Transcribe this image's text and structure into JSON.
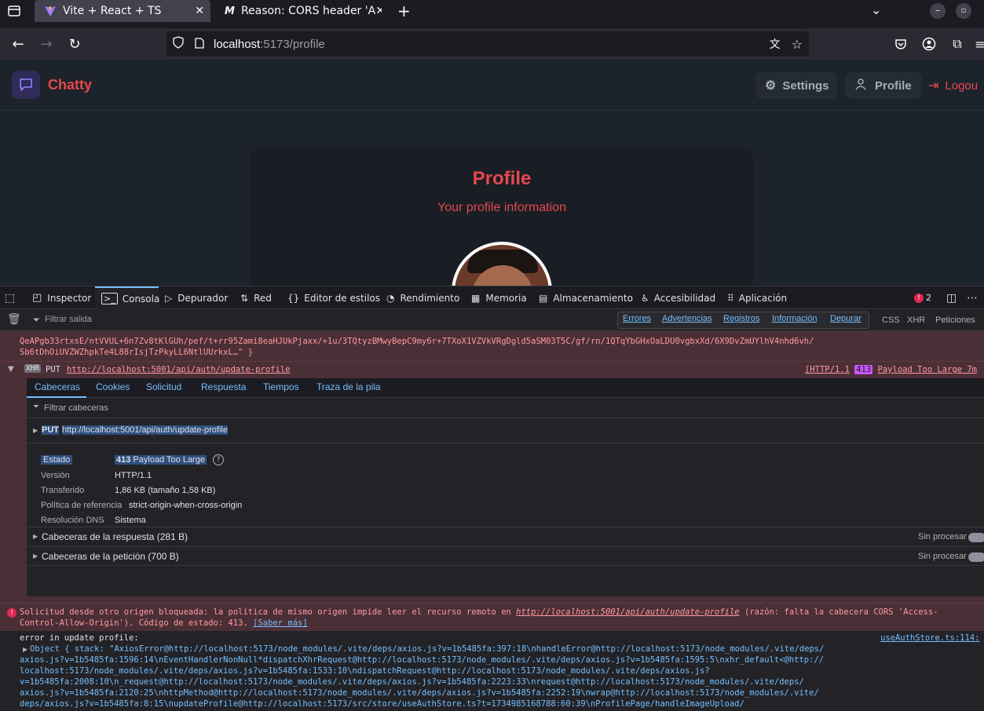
{
  "browser": {
    "tabs": [
      {
        "title": "Vite + React + TS",
        "active": true
      },
      {
        "title": "Reason: CORS header 'A",
        "active": false
      }
    ],
    "new_tab_label": "+",
    "url_host": "localhost",
    "url_rest": ":5173/profile"
  },
  "app": {
    "brand": "Chatty",
    "nav": {
      "settings": "Settings",
      "profile": "Profile",
      "logout": "Logou"
    },
    "card_title": "Profile",
    "card_subtitle": "Your profile information"
  },
  "devtools": {
    "tabs": [
      "Inspector",
      "Consola",
      "Depurador",
      "Red",
      "Editor de estilos",
      "Rendimiento",
      "Memoria",
      "Almacenamiento",
      "Accesibilidad",
      "Aplicación"
    ],
    "active_tab": "Consola",
    "error_count": "2",
    "filter_placeholder": "Filtrar salida",
    "levels": [
      "Errores",
      "Advertencias",
      "Registros",
      "Información",
      "Depurar"
    ],
    "request_types": [
      "CSS",
      "XHR",
      "Peticiones"
    ],
    "prev_log_line1": "QeAPgb33rtxsE/ntVVUL+6n7Zv8tKlGUh/pef/t+rr95Zami8eaHJUkPjaxx/+1u/3TQtyzBMwyBepC9my6r+7TXoX1VZVkVRgDgld5aSM03T5C/gf/rn/1QTqYbGHxOaLDU0vgbxXd/6X9DvZmUYlhV4nhd6vh/",
    "prev_log_line2": "Sb6tDhOiUVZWZhpkTe4L88rIsjTzPkyLL6NtlUUrkxL…\" }",
    "xhr": {
      "badge": "XHR",
      "method": "PUT",
      "url": "http://localhost:5001/api/auth/update-profile",
      "status_prefix": "[HTTP/1.1",
      "status_code": "413",
      "status_text": "Payload Too Large 7m"
    },
    "net_tabs": [
      "Cabeceras",
      "Cookies",
      "Solicitud",
      "Respuesta",
      "Tiempos",
      "Traza de la pila"
    ],
    "header_filter": "Filtrar cabeceras",
    "request_line": {
      "method": "PUT",
      "url": "http://localhost:5001/api/auth/update-profile"
    },
    "details": [
      {
        "key": "Estado",
        "value_code": "413",
        "value": "Payload Too Large"
      },
      {
        "key": "Versión",
        "value": "HTTP/1.1"
      },
      {
        "key": "Transferido",
        "value": "1,86 KB (tamaño 1,58 KB)"
      },
      {
        "key": "Política de referencia",
        "value": "strict-origin-when-cross-origin"
      },
      {
        "key": "Resolución DNS",
        "value": "Sistema"
      }
    ],
    "sections": [
      {
        "label": "Cabeceras de la respuesta (281 B)",
        "raw": "Sin procesar"
      },
      {
        "label": "Cabeceras de la petición (700 B)",
        "raw": "Sin procesar"
      }
    ],
    "cors_error": {
      "text1": "Solicitud desde otro origen bloqueada: la política de mismo origen impide leer el recurso remoto en ",
      "link": "http://localhost:5001/api/auth/update-profile",
      "text2": " (razón: falta la cabecera CORS 'Access-",
      "text3": "Control-Allow-Origin'). Código de estado: 413. ",
      "learn_more": "[Saber más]"
    },
    "log": {
      "title": "error in update profile:",
      "source": "useAuthStore.ts:114:",
      "lines": [
        "Object { stack: \"AxiosError@http://localhost:5173/node_modules/.vite/deps/axios.js?v=1b5485fa:397:18\\nhandleError@http://localhost:5173/node_modules/.vite/deps/",
        "axios.js?v=1b5485fa:1596:14\\nEventHandlerNonNull*dispatchXhrRequest@http://localhost:5173/node_modules/.vite/deps/axios.js?v=1b5485fa:1595:5\\nxhr_default<@http://",
        "localhost:5173/node_modules/.vite/deps/axios.js?v=1b5485fa:1533:10\\ndispatchRequest@http://localhost:5173/node_modules/.vite/deps/axios.js?",
        "v=1b5485fa:2008:10\\n_request@http://localhost:5173/node_modules/.vite/deps/axios.js?v=1b5485fa:2223:33\\nrequest@http://localhost:5173/node_modules/.vite/deps/",
        "axios.js?v=1b5485fa:2120:25\\nhttpMethod@http://localhost:5173/node_modules/.vite/deps/axios.js?v=1b5485fa:2252:19\\nwrap@http://localhost:5173/node_modules/.vite/",
        "deps/axios.js?v=1b5485fa:8:15\\nupdateProfile@http://localhost:5173/src/store/useAuthStore.ts?t=1734985168788:60:39\\nProfilePage/handleImageUpload/"
      ]
    }
  }
}
